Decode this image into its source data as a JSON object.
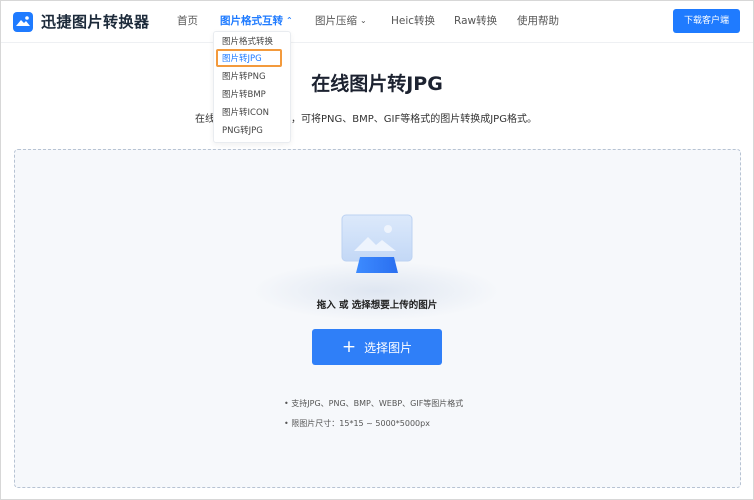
{
  "brand": {
    "name": "迅捷图片转换器",
    "icon": "image-logo-icon",
    "color": "#1f7bff"
  },
  "nav": {
    "items": [
      {
        "label": "首页"
      },
      {
        "label": "图片格式互转",
        "active": true
      },
      {
        "label": "图片压缩"
      },
      {
        "label": "Heic转换"
      },
      {
        "label": "Raw转换"
      },
      {
        "label": "使用帮助"
      }
    ],
    "cta_label": "下载客户端"
  },
  "dropdown": {
    "items": [
      {
        "label": "图片格式转换"
      },
      {
        "label": "图片转JPG",
        "selected": true
      },
      {
        "label": "图片转PNG"
      },
      {
        "label": "图片转BMP"
      },
      {
        "label": "图片转ICON"
      },
      {
        "label": "PNG转JPG"
      }
    ],
    "highlight_color": "#f39a3c"
  },
  "hero": {
    "title": "在线图片转JPG",
    "subtitle_left": "在线",
    "subtitle_right": "，可将PNG、BMP、GIF等格式的图片转换成JPG格式。"
  },
  "upload": {
    "hint": "拖入 或 选择想要上传的图片",
    "button_label": "选择图片",
    "notes": [
      "• 支持JPG、PNG、BMP、WEBP、GIF等图片格式",
      "• 限图片尺寸：15*15 ~ 5000*5000px"
    ]
  }
}
